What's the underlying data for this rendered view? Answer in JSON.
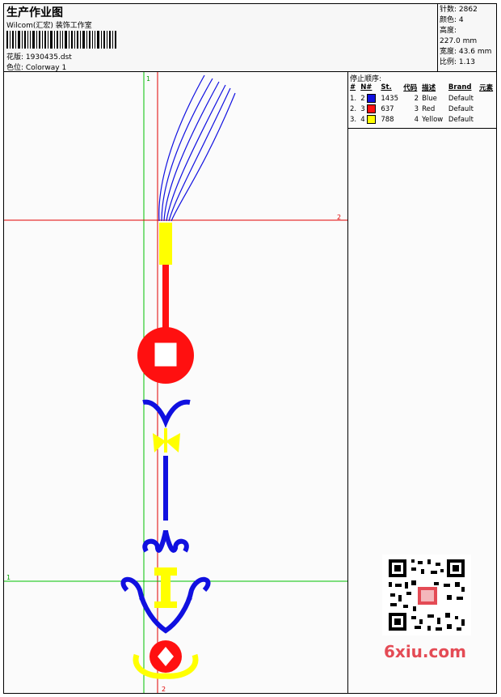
{
  "header": {
    "title": "生产作业图",
    "company": "Wilcom(汇宏) 装饰工作室",
    "file_label": "花版:",
    "file_value": "1930435.dst",
    "colorway_label": "色位:",
    "colorway_value": "Colorway 1"
  },
  "stats": {
    "stitches_label": "针数:",
    "stitches_value": "2862",
    "colors_label": "颜色:",
    "colors_value": "4",
    "height_label": "高度:",
    "height_value": "227.0 mm",
    "width_label": "宽度:",
    "width_value": "43.6 mm",
    "scale_label": "比例:",
    "scale_value": "1.13"
  },
  "stop_sequence": {
    "title": "停止顺序:",
    "columns": [
      "#",
      "N#",
      "St.",
      "代码",
      "描述",
      "Brand",
      "元素"
    ],
    "rows": [
      {
        "num": "1.",
        "needle": "2",
        "color": "#1010e0",
        "stitches": "1435",
        "code": "2",
        "desc": "Blue",
        "brand": "Default"
      },
      {
        "num": "2.",
        "needle": "3",
        "color": "#ff1010",
        "stitches": "637",
        "code": "3",
        "desc": "Red",
        "brand": "Default"
      },
      {
        "num": "3.",
        "needle": "4",
        "color": "#ffff00",
        "stitches": "788",
        "code": "4",
        "desc": "Yellow",
        "brand": "Default"
      }
    ]
  },
  "markers": {
    "v_top": "1",
    "h_right": "2",
    "h_left": "1",
    "v_bottom": "2"
  },
  "watermark": "6xiu.com",
  "colors": {
    "blue": "#1010e0",
    "red": "#ff1010",
    "yellow": "#ffff00",
    "guide_red": "#e00000",
    "guide_green": "#00c000"
  }
}
